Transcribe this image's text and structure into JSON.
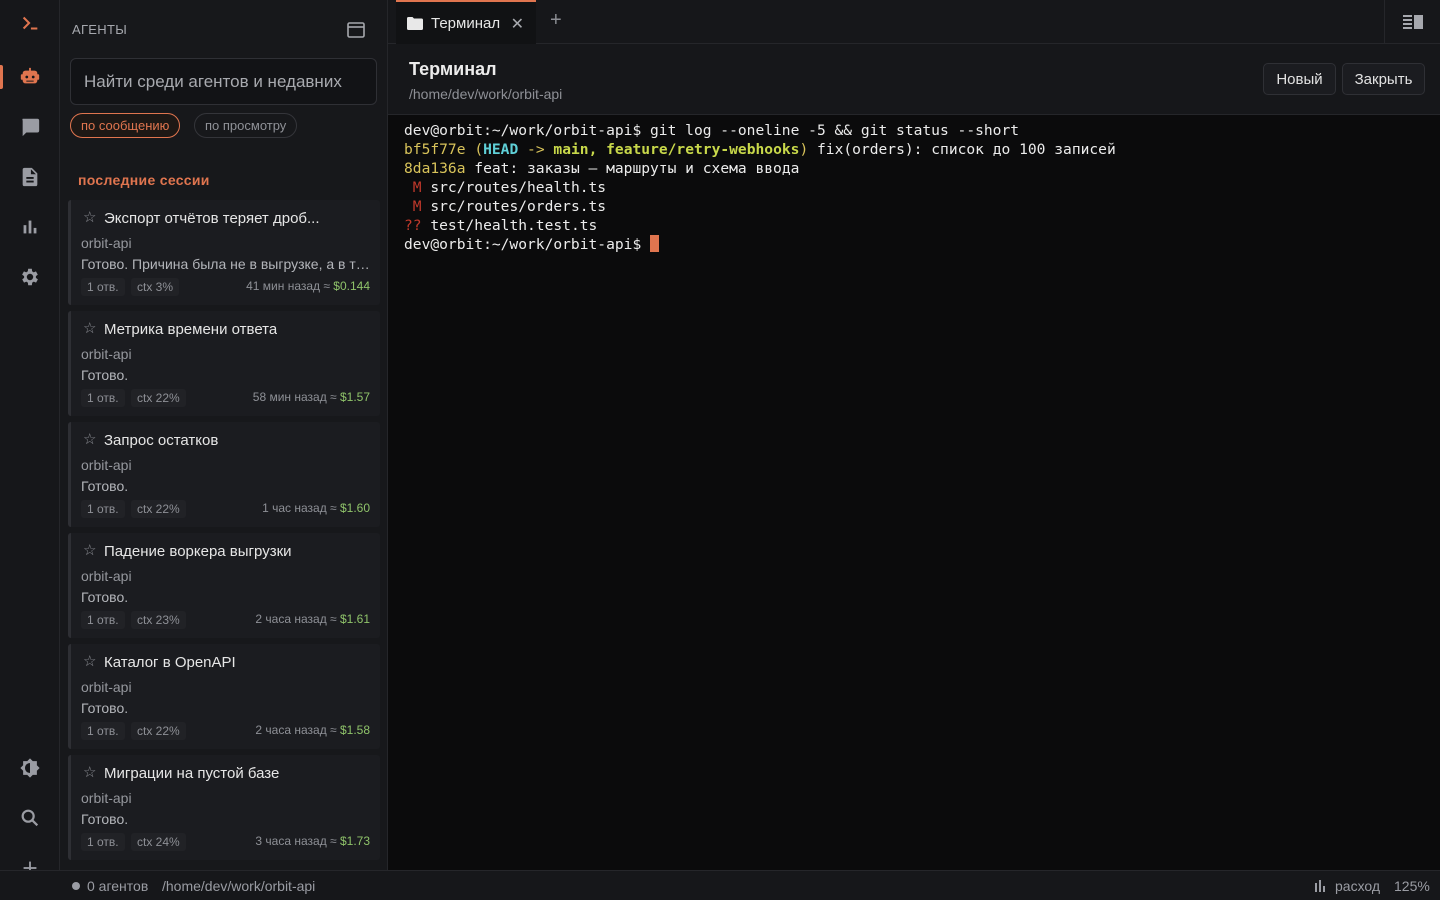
{
  "rail": {
    "items": [
      {
        "id": "terminal",
        "icon": "terminal-prompt-icon"
      },
      {
        "id": "agents",
        "icon": "robot-icon",
        "active": true
      },
      {
        "id": "chat",
        "icon": "chat-bubble-icon"
      },
      {
        "id": "docs",
        "icon": "document-icon"
      },
      {
        "id": "stats",
        "icon": "bar-chart-icon"
      },
      {
        "id": "settings",
        "icon": "gear-icon"
      }
    ],
    "bottom": [
      {
        "id": "theme",
        "icon": "theme-toggle-icon"
      },
      {
        "id": "search",
        "icon": "search-icon"
      },
      {
        "id": "add",
        "icon": "plus-icon"
      }
    ]
  },
  "panel": {
    "header": "АГЕНТЫ",
    "search_placeholder": "Найти среди агентов и недавних",
    "filters": {
      "by_message": "по сообщению",
      "by_view": "по просмотру"
    },
    "section_title": "последние сессии",
    "sessions": [
      {
        "title": "Экспорт отчётов теряет дроб...",
        "repo": "orbit-api",
        "preview": "Готово. Причина была не в выгрузке, а в ти...",
        "replies": "1 отв.",
        "ctx": "ctx 3%",
        "time": "41 мин назад ≈",
        "cost": "$0.144"
      },
      {
        "title": "Метрика времени ответа",
        "repo": "orbit-api",
        "preview": "Готово.",
        "replies": "1 отв.",
        "ctx": "ctx 22%",
        "time": "58 мин назад ≈",
        "cost": "$1.57"
      },
      {
        "title": "Запрос остатков",
        "repo": "orbit-api",
        "preview": "Готово.",
        "replies": "1 отв.",
        "ctx": "ctx 22%",
        "time": "1 час назад ≈",
        "cost": "$1.60"
      },
      {
        "title": "Падение воркера выгрузки",
        "repo": "orbit-api",
        "preview": "Готово.",
        "replies": "1 отв.",
        "ctx": "ctx 23%",
        "time": "2 часа назад ≈",
        "cost": "$1.61"
      },
      {
        "title": "Каталог в OpenAPI",
        "repo": "orbit-api",
        "preview": "Готово.",
        "replies": "1 отв.",
        "ctx": "ctx 22%",
        "time": "2 часа назад ≈",
        "cost": "$1.58"
      },
      {
        "title": "Миграции на пустой базе",
        "repo": "orbit-api",
        "preview": "Готово.",
        "replies": "1 отв.",
        "ctx": "ctx 24%",
        "time": "3 часа назад ≈",
        "cost": "$1.73"
      }
    ]
  },
  "tabs": {
    "active_label": "Терминал",
    "close_glyph": "✕",
    "add_glyph": "+"
  },
  "terminal": {
    "title": "Терминал",
    "path": "/home/dev/work/orbit-api",
    "new_label": "Новый",
    "close_label": "Закрыть",
    "lines": {
      "cmd_prompt": "dev@orbit:~/work/orbit-api$ ",
      "cmd": "git log --oneline -5 && git status --short",
      "c1_hash": "bf5f77e",
      "c1_head": "HEAD",
      "c1_arrow": " -> ",
      "c1_branches": "main, feature/retry-webhooks",
      "c1_msg": " fix(orders): список до 100 записей",
      "c2_hash": "8da136a",
      "c2_msg": " feat: заказы — маршруты и схема ввода",
      "s1_flag": " M",
      "s1_file": " src/routes/health.ts",
      "s2_flag": " M",
      "s2_file": " src/routes/orders.ts",
      "s3_flag": "??",
      "s3_file": " test/health.test.ts",
      "end_prompt": "dev@orbit:~/work/orbit-api$ "
    }
  },
  "statusbar": {
    "agents": "0 агентов",
    "path": "/home/dev/work/orbit-api",
    "usage": "расход",
    "zoom": "125%"
  },
  "colors": {
    "accent": "#e0754f",
    "cost": "#8fc36a",
    "hash": "#d8c35a",
    "head": "#5fd0d8"
  }
}
